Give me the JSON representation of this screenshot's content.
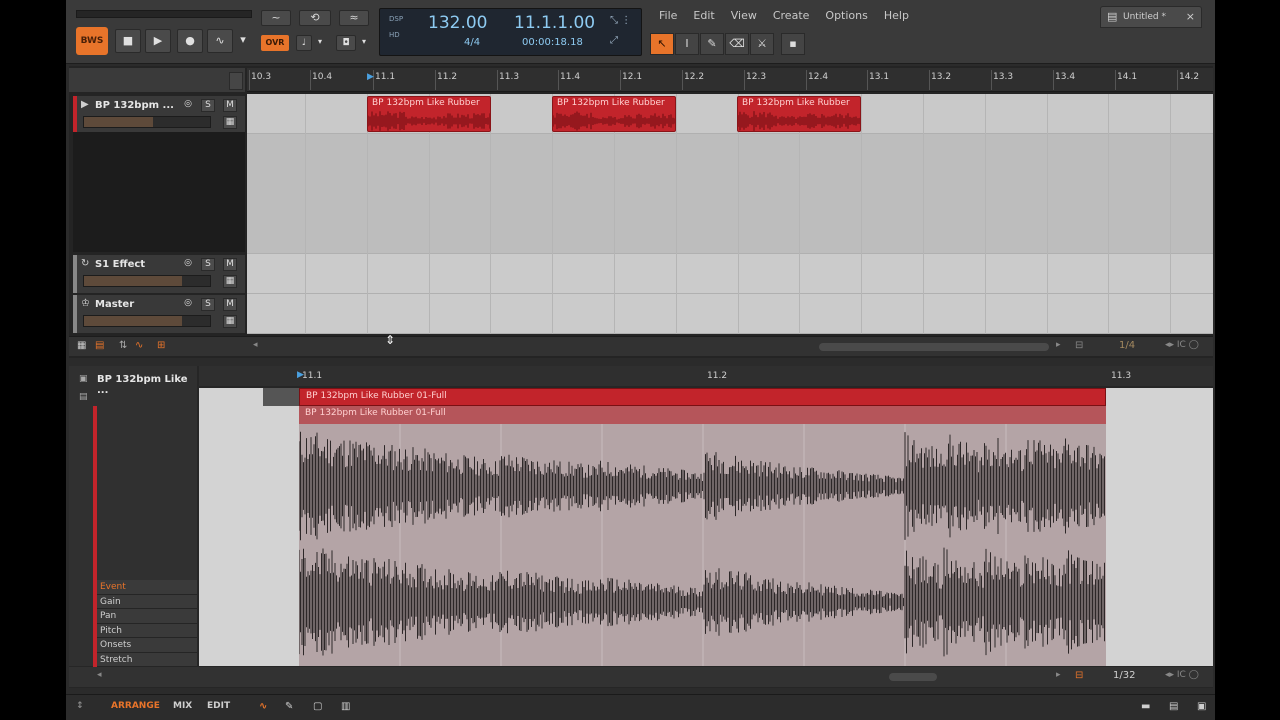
{
  "window": {
    "tab_title": "Untitled *"
  },
  "menu": [
    "File",
    "Edit",
    "View",
    "Create",
    "Options",
    "Help"
  ],
  "transport": {
    "logo": "BWS",
    "overdub_label": "OVR",
    "dsp_label": "DSP",
    "hd_label": "HD",
    "tempo": "132.00",
    "time_signature": "4/4",
    "position": "11.1.1.00",
    "time": "00:00:18.18"
  },
  "arranger": {
    "ruler_ticks": [
      "10.3",
      "10.4",
      "11.1",
      "11.2",
      "11.3",
      "11.4",
      "12.1",
      "12.2",
      "12.3",
      "12.4",
      "13.1",
      "13.2",
      "13.3",
      "13.4",
      "14.1",
      "14.2"
    ],
    "tracks": [
      {
        "name": "BP 132bpm ...",
        "solo": "S",
        "mute": "M",
        "volume": 0.55
      },
      {
        "name": "S1 Effect",
        "solo": "S",
        "mute": "M",
        "volume": 0.78
      },
      {
        "name": "Master",
        "solo": "S",
        "mute": "M",
        "volume": 0.78
      }
    ],
    "clips": [
      {
        "name": "BP 132bpm Like Rubber"
      },
      {
        "name": "BP 132bpm Like Rubber"
      },
      {
        "name": "BP 132bpm Like Rubber"
      }
    ],
    "zoom": "1/4"
  },
  "editor": {
    "track_name": "BP 132bpm Like ...",
    "ruler_ticks": [
      "11.1",
      "11.2",
      "11.3"
    ],
    "clip_name": "BP 132bpm Like Rubber 01-Full",
    "event_name": "BP 132bpm Like Rubber 01-Full",
    "properties": [
      "Event",
      "Gain",
      "Pan",
      "Pitch",
      "Onsets",
      "Stretch"
    ],
    "zoom": "1/32"
  },
  "footer": {
    "arrange": "ARRANGE",
    "mix": "MIX",
    "edit": "EDIT"
  },
  "colors": {
    "accent": "#e8742a",
    "clip": "#c2242b",
    "display_text": "#8ecbf2"
  }
}
